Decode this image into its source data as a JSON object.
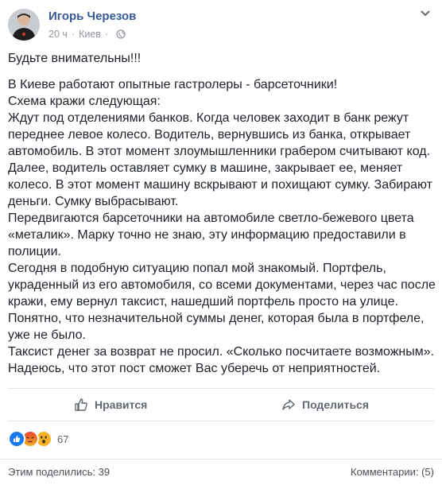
{
  "post": {
    "author": "Игорь Черезов",
    "time": "20 ч",
    "separator": "·",
    "location": "Киев",
    "icons": [
      "globe-icon",
      "chevron-down-icon"
    ],
    "paragraphs": [
      "Будьте внимательны!!!",
      "В Киеве работают опытные гастролеры - барсеточники!",
      "Схема кражи следующая:",
      "Ждут под отделениями банков. Когда человек заходит в банк режут переднее левое колесо. Водитель, вернувшись из банка, открывает автомобиль. В этот момент злоумышленники грабером считывают код. Далее, водитель оставляет сумку в машине, закрывает ее, меняет колесо. В этот момент машину вскрывают и похищают сумку. Забирают деньги. Сумку выбрасывают.",
      "Передвигаются барсеточники на автомобиле светло-бежевого цвета «металик». Марку точно не знаю, эту информацию предоставили в полиции.",
      "Сегодня в подобную ситуацию попал мой знакомый. Портфель, украденный из его автомобиля, со всеми документами, через час после кражи, ему вернул таксист, нашедший портфель просто на улице. Понятно, что незначительной суммы денег, которая была в портфеле, уже не было.",
      "Таксист денег за возврат не просил. «Сколько посчитаете возможным». Надеюсь, что этот пост сможет Вас уберечь от неприятностей."
    ]
  },
  "actions": {
    "like_label": "Нравится",
    "share_label": "Поделиться"
  },
  "reactions": {
    "types": [
      "like",
      "angry",
      "wow"
    ],
    "count": "67"
  },
  "footer": {
    "shares": "Этим поделились: 39",
    "comments": "Комментарии: (5)"
  },
  "colors": {
    "author": "#365899",
    "meta": "#90949c",
    "like_blue": "#1877f2",
    "angry": "#e9710f",
    "wow": "#f7b125"
  }
}
